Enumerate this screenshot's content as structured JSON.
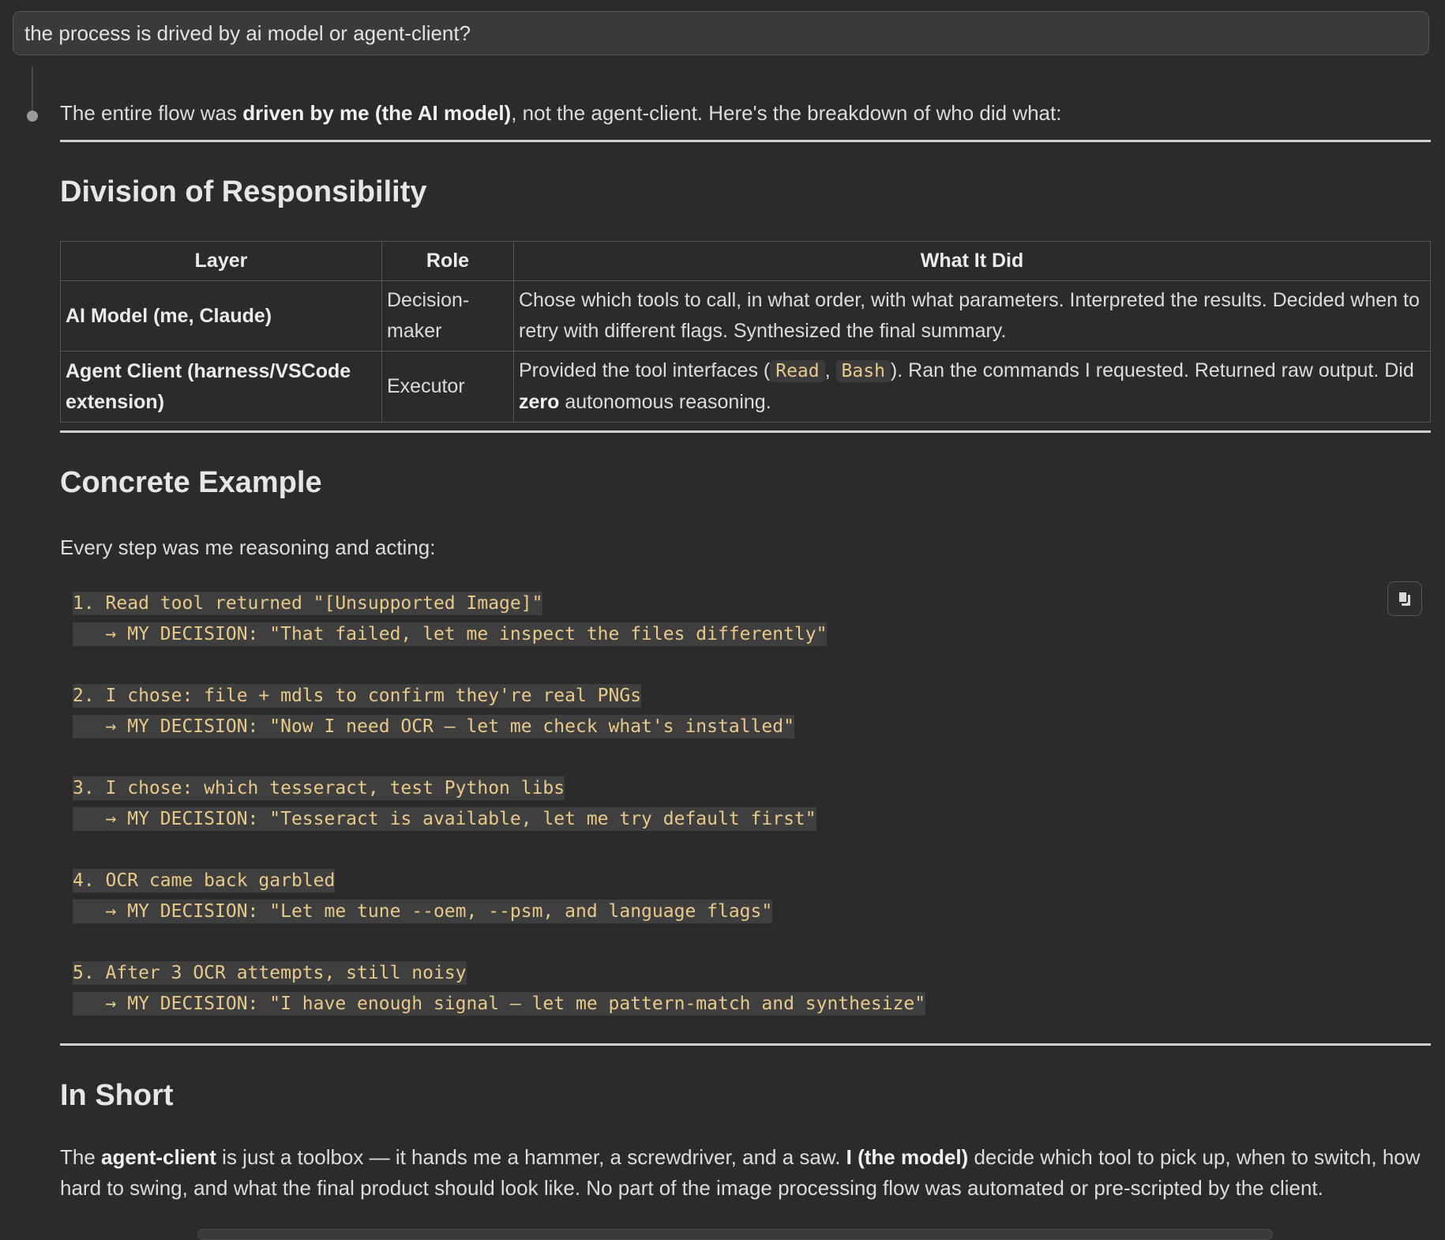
{
  "prompt": {
    "text": "the process is drived by ai model or agent-client?"
  },
  "intro": {
    "pre": "The entire flow was ",
    "bold": "driven by me (the AI model)",
    "post": ", not the agent-client. Here's the breakdown of who did what:"
  },
  "section1": {
    "title": "Division of Responsibility"
  },
  "table": {
    "headers": [
      "Layer",
      "Role",
      "What It Did"
    ],
    "rows": [
      {
        "layer": "AI Model (me, Claude)",
        "role": "Decision-maker",
        "what": "Chose which tools to call, in what order, with what parameters. Interpreted the results. Decided when to retry with different flags. Synthesized the final summary."
      },
      {
        "layer": "Agent Client (harness/VSCode extension)",
        "role": "Executor",
        "what_pre": "Provided the tool interfaces (",
        "code1": "Read",
        "sep": ", ",
        "code2": "Bash",
        "what_mid": "). Ran the commands I requested. Returned raw output. Did ",
        "what_bold": "zero",
        "what_post": " autonomous reasoning."
      }
    ]
  },
  "section2": {
    "title": "Concrete Example"
  },
  "lead": "Every step was me reasoning and acting:",
  "code": {
    "steps": [
      {
        "line1": "1. Read tool returned \"[Unsupported Image]\"",
        "line2": "   → MY DECISION: \"That failed, let me inspect the files differently\""
      },
      {
        "line1": "2. I chose: file + mdls to confirm they're real PNGs",
        "line2": "   → MY DECISION: \"Now I need OCR — let me check what's installed\""
      },
      {
        "line1": "3. I chose: which tesseract, test Python libs",
        "line2": "   → MY DECISION: \"Tesseract is available, let me try default first\""
      },
      {
        "line1": "4. OCR came back garbled",
        "line2": "   → MY DECISION: \"Let me tune --oem, --psm, and language flags\""
      },
      {
        "line1": "5. After 3 OCR attempts, still noisy",
        "line2": "   → MY DECISION: \"I have enough signal — let me pattern-match and synthesize\""
      }
    ],
    "copy_icon": "clipboard-icon"
  },
  "section3": {
    "title": "In Short"
  },
  "summary": {
    "t1": "The ",
    "b1": "agent-client",
    "t2": " is just a toolbox — it hands me a hammer, a screwdriver, and a saw. ",
    "b2": "I (the model)",
    "t3": " decide which tool to pick up, when to switch, how hard to swing, and what the final product should look like. No part of the image processing flow was automated or pre-scripted by the client."
  }
}
